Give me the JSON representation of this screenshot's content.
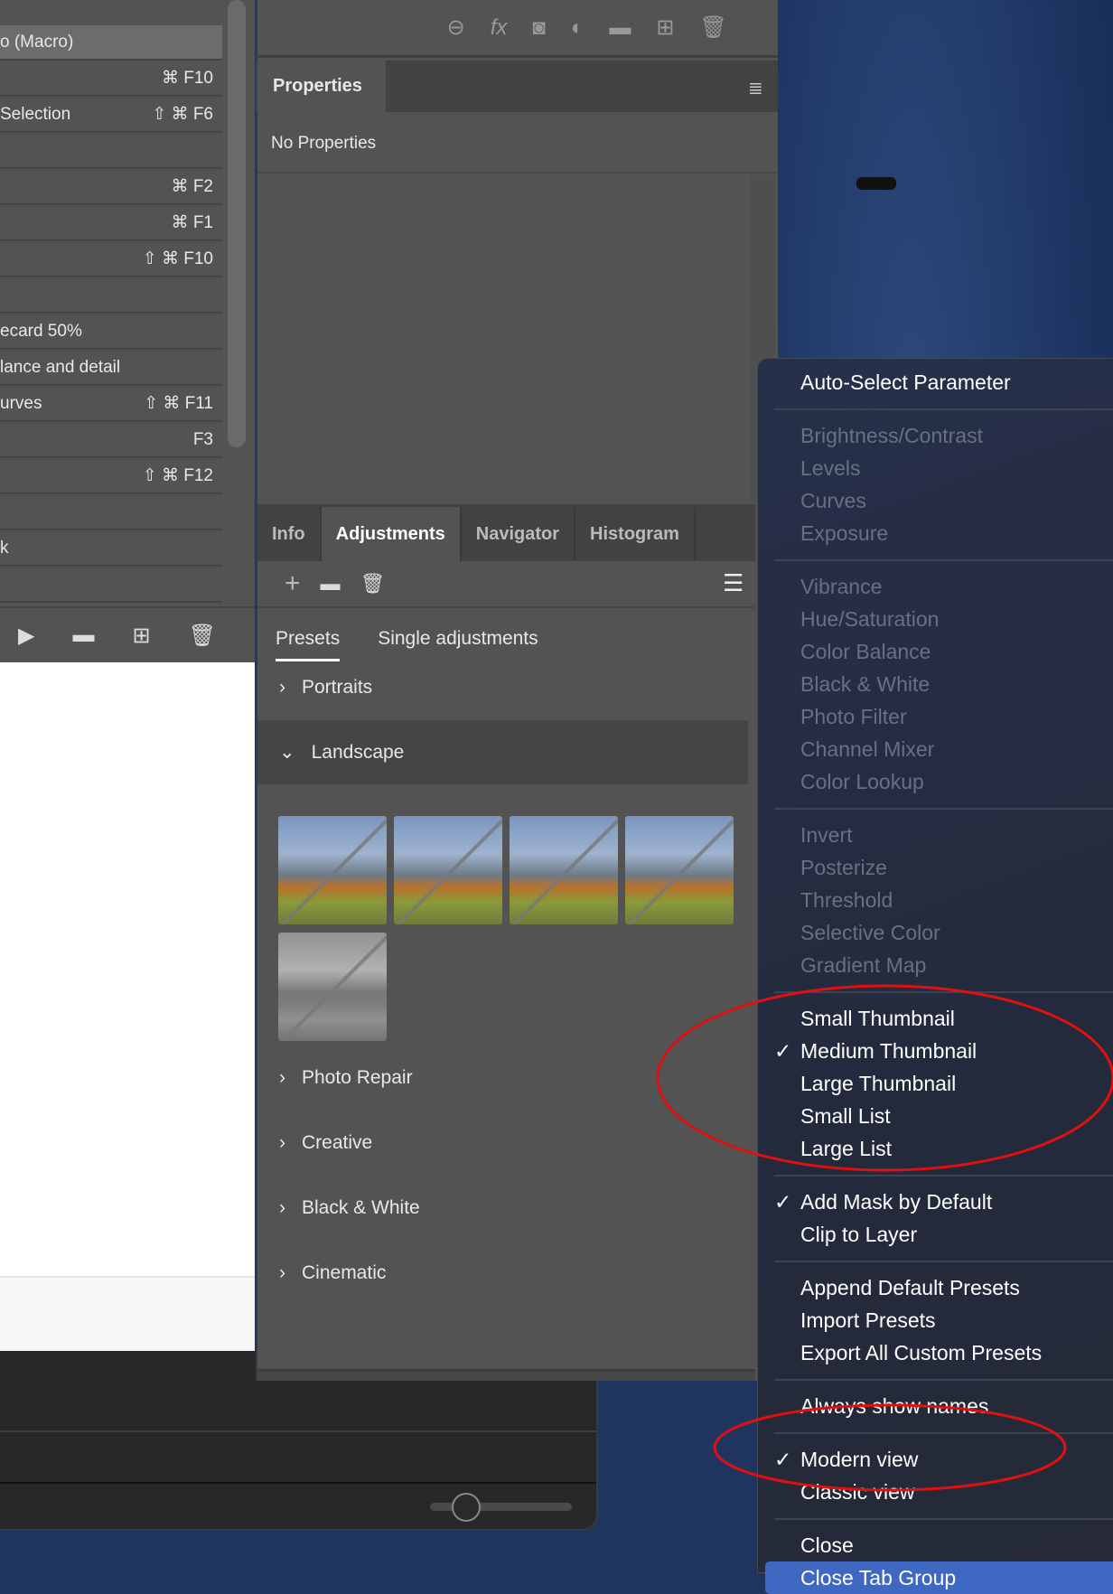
{
  "actions_panel": {
    "rows": [
      {
        "label": "o (Macro)",
        "shortcut": ""
      },
      {
        "label": "",
        "shortcut": "⌘ F10"
      },
      {
        "label": "Selection",
        "shortcut": "⇧ ⌘ F6"
      },
      {
        "label": "",
        "shortcut": ""
      },
      {
        "label": "",
        "shortcut": "⌘ F2"
      },
      {
        "label": "",
        "shortcut": "⌘ F1"
      },
      {
        "label": "",
        "shortcut": "⇧ ⌘ F10"
      },
      {
        "label": "",
        "shortcut": ""
      },
      {
        "label": "ecard 50%",
        "shortcut": ""
      },
      {
        "label": "lance and detail",
        "shortcut": ""
      },
      {
        "label": "urves",
        "shortcut": "⇧ ⌘ F11"
      },
      {
        "label": "",
        "shortcut": "F3"
      },
      {
        "label": "",
        "shortcut": "⇧ ⌘ F12"
      },
      {
        "label": "",
        "shortcut": ""
      },
      {
        "label": "k",
        "shortcut": ""
      },
      {
        "label": "",
        "shortcut": ""
      }
    ]
  },
  "properties": {
    "tab": "Properties",
    "empty_text": "No Properties"
  },
  "adjustments": {
    "tabs": [
      "Info",
      "Adjustments",
      "Navigator",
      "Histogram"
    ],
    "active_tab": "Adjustments",
    "subtabs": [
      "Presets",
      "Single adjustments"
    ],
    "groups": [
      "Portraits",
      "Landscape",
      "Photo Repair",
      "Creative",
      "Black & White",
      "Cinematic"
    ],
    "expanded": "Landscape",
    "thumbnail_count": 5
  },
  "menu": {
    "groups": [
      [
        {
          "label": "Auto-Select Parameter",
          "enabled": true
        }
      ],
      [
        {
          "label": "Brightness/Contrast"
        },
        {
          "label": "Levels"
        },
        {
          "label": "Curves"
        },
        {
          "label": "Exposure"
        }
      ],
      [
        {
          "label": "Vibrance"
        },
        {
          "label": "Hue/Saturation"
        },
        {
          "label": "Color Balance"
        },
        {
          "label": "Black & White"
        },
        {
          "label": "Photo Filter"
        },
        {
          "label": "Channel Mixer"
        },
        {
          "label": "Color Lookup"
        }
      ],
      [
        {
          "label": "Invert"
        },
        {
          "label": "Posterize"
        },
        {
          "label": "Threshold"
        },
        {
          "label": "Selective Color"
        },
        {
          "label": "Gradient Map"
        }
      ],
      [
        {
          "label": "Small Thumbnail",
          "enabled": true
        },
        {
          "label": "Medium Thumbnail",
          "enabled": true,
          "checked": true
        },
        {
          "label": "Large Thumbnail",
          "enabled": true
        },
        {
          "label": "Small List",
          "enabled": true
        },
        {
          "label": "Large List",
          "enabled": true
        }
      ],
      [
        {
          "label": "Add Mask by Default",
          "enabled": true,
          "checked": true
        },
        {
          "label": "Clip to Layer",
          "enabled": true
        }
      ],
      [
        {
          "label": "Append Default Presets",
          "enabled": true
        },
        {
          "label": "Import Presets",
          "enabled": true
        },
        {
          "label": "Export All Custom Presets",
          "enabled": true
        }
      ],
      [
        {
          "label": "Always show names",
          "enabled": true
        }
      ],
      [
        {
          "label": "Modern view",
          "enabled": true,
          "checked": true
        },
        {
          "label": "Classic view",
          "enabled": true
        }
      ],
      [
        {
          "label": "Close",
          "enabled": true
        },
        {
          "label": "Close Tab Group",
          "enabled": true,
          "highlighted": true
        }
      ]
    ]
  },
  "check_glyph": "✓",
  "colors": {
    "annotation": "#e01010",
    "menu_highlight": "#3f68c2"
  }
}
